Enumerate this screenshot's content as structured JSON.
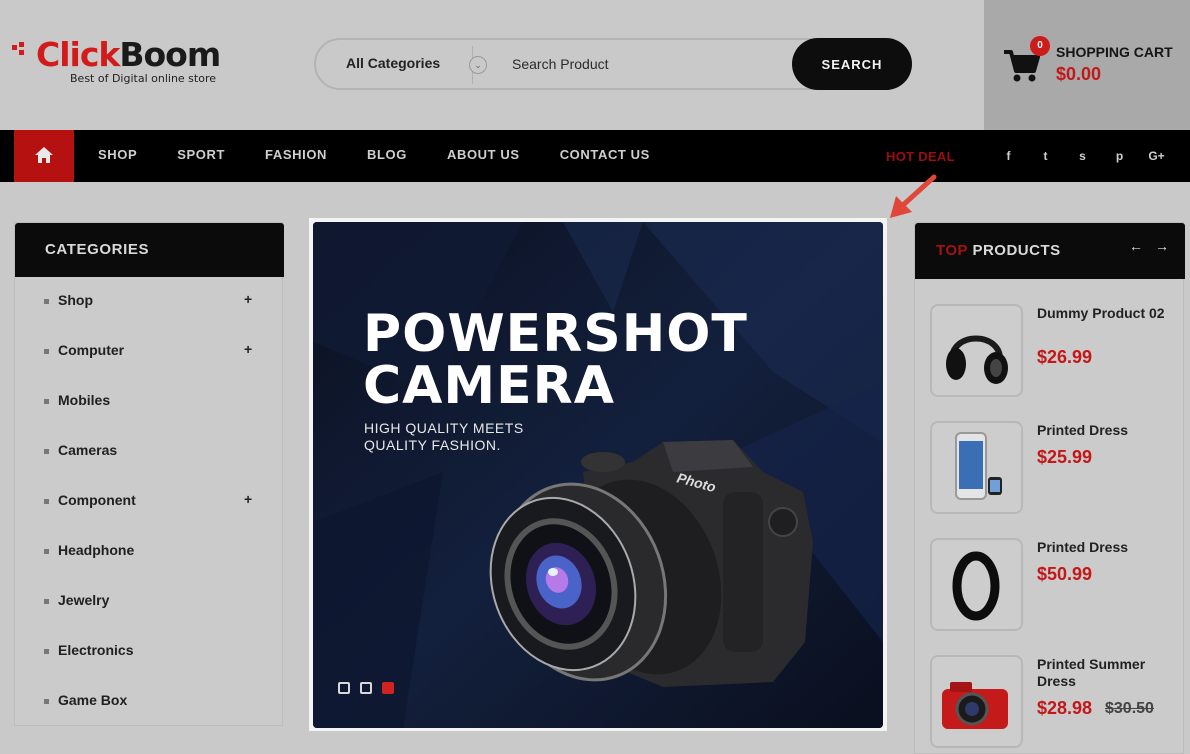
{
  "brand": {
    "name_part1": "Click",
    "name_part2": "Boom",
    "tagline": "Best of Digital online store",
    "accent": "#d21c1c"
  },
  "search": {
    "category": "All Categories",
    "placeholder": "Search Product",
    "button": "SEARCH"
  },
  "cart": {
    "count": "0",
    "label": "SHOPPING CART",
    "total": "$0.00"
  },
  "nav": {
    "items": [
      "SHOP",
      "SPORT",
      "FASHION",
      "BLOG",
      "ABOUT US",
      "CONTACT US"
    ],
    "hot_deal": "HOT DEAL",
    "socials": [
      "f",
      "t",
      "s",
      "p",
      "G+"
    ]
  },
  "categories": {
    "title": "CATEGORIES",
    "items": [
      {
        "label": "Shop",
        "expand": "+"
      },
      {
        "label": "Computer",
        "expand": "+"
      },
      {
        "label": "Mobiles",
        "expand": ""
      },
      {
        "label": "Cameras",
        "expand": ""
      },
      {
        "label": "Component",
        "expand": "+"
      },
      {
        "label": "Headphone",
        "expand": ""
      },
      {
        "label": "Jewelry",
        "expand": ""
      },
      {
        "label": "Electronics",
        "expand": ""
      },
      {
        "label": "Game Box",
        "expand": ""
      }
    ]
  },
  "banner": {
    "title_line1": "POWERSHOT",
    "title_line2": "CAMERA",
    "sub_line1": "HIGH QUALITY MEETS",
    "sub_line2": "QUALITY FASHION.",
    "slides": 3,
    "active_slide": 3
  },
  "top_products": {
    "title_red": "TOP",
    "title_rest": " PRODUCTS",
    "items": [
      {
        "name": "Dummy Product 02",
        "price": "$26.99",
        "old_price": "",
        "icon": "headphones-icon"
      },
      {
        "name": "Printed Dress",
        "price": "$25.99",
        "old_price": "",
        "icon": "phone-icon"
      },
      {
        "name": "Printed Dress",
        "price": "$50.99",
        "old_price": "",
        "icon": "fitness-band-icon"
      },
      {
        "name": "Printed Summer Dress",
        "price": "$28.98",
        "old_price": "$30.50",
        "icon": "red-camera-icon"
      }
    ]
  }
}
